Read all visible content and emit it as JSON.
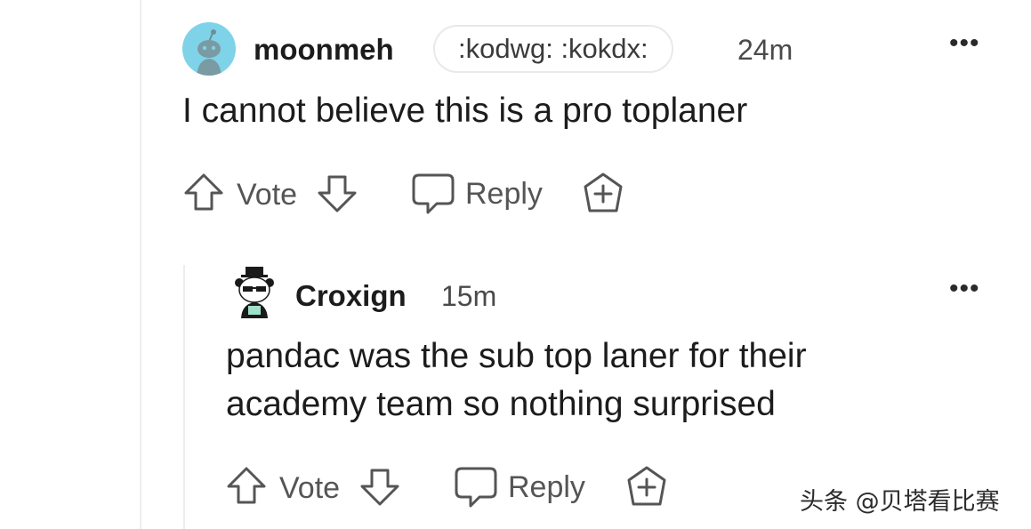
{
  "comment1": {
    "username": "moonmeh",
    "flair": ":kodwg: :kokdx:",
    "time": "24m",
    "more": "•••",
    "body": "I cannot believe this is a pro toplaner",
    "vote_label": "Vote",
    "reply_label": "Reply"
  },
  "comment2": {
    "username": "Croxign",
    "time": "15m",
    "more": "•••",
    "body_lines": [
      "pandac was the sub top laner for their",
      "academy team so nothing surprised"
    ],
    "vote_label": "Vote",
    "reply_label": "Reply"
  },
  "watermark": "头条 @贝塔看比赛",
  "icons": {
    "upvote": "arrow-up-outline-icon",
    "downvote": "arrow-down-outline-icon",
    "reply": "speech-bubble-icon",
    "award": "award-plus-icon",
    "more": "more-horizontal-icon"
  },
  "colors": {
    "text": "#1c1c1c",
    "muted": "#555555",
    "avatar_bg": "#7fd3e8",
    "thread_line": "#ededed"
  }
}
